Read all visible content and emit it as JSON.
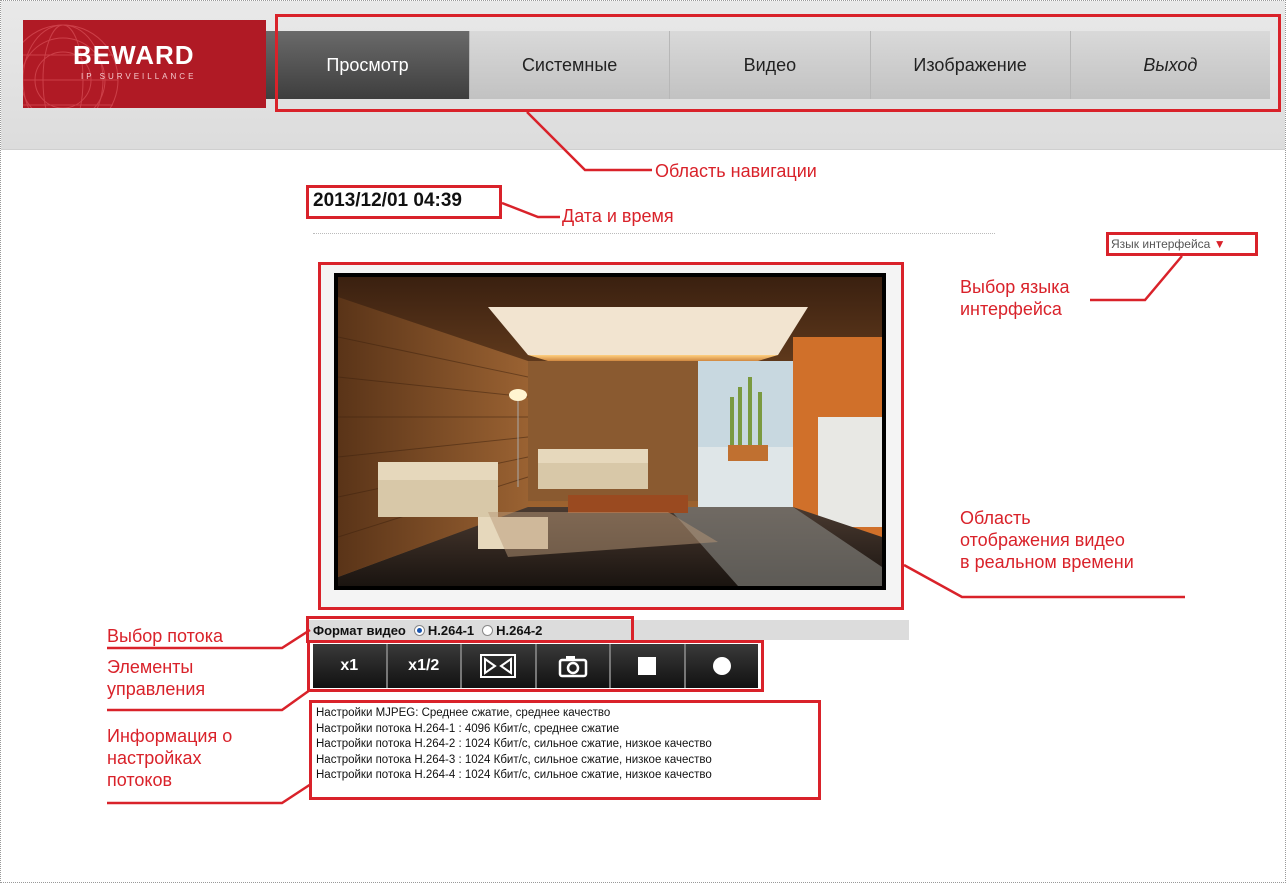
{
  "logo": {
    "brand": "BEWARD",
    "sub": "IP SURVEILLANCE"
  },
  "nav": {
    "items": [
      {
        "label": "Просмотр",
        "active": true
      },
      {
        "label": "Системные"
      },
      {
        "label": "Видео"
      },
      {
        "label": "Изображение"
      },
      {
        "label": "Выход"
      }
    ]
  },
  "datetime": "2013/12/01 04:39",
  "language": {
    "label": "Язык интерфейса",
    "arrow": "▼"
  },
  "format": {
    "label": "Формат видео",
    "options": [
      {
        "label": "H.264-1",
        "selected": true
      },
      {
        "label": "H.264-2",
        "selected": false
      }
    ]
  },
  "controls": {
    "x1": "x1",
    "x12": "x1/2"
  },
  "info": [
    "Настройки MJPEG: Среднее сжатие, среднее качество",
    "Настройки потока H.264-1 : 4096 Кбит/с, среднее сжатие",
    "Настройки потока H.264-2 : 1024 Кбит/с, сильное сжатие, низкое качество",
    "Настройки потока H.264-3 : 1024 Кбит/с, сильное сжатие, низкое качество",
    "Настройки потока H.264-4 : 1024 Кбит/с, сильное сжатие, низкое качество"
  ],
  "annotations": {
    "nav": "Область навигации",
    "datetime": "Дата и время",
    "lang_line1": "Выбор языка",
    "lang_line2": "интерфейса",
    "video_line1": "Область",
    "video_line2": "отображения видео",
    "video_line3": "в реальном времени",
    "stream": "Выбор потока",
    "controls_line1": "Элементы",
    "controls_line2": "управления",
    "info_line1": "Информация о",
    "info_line2": "настройках",
    "info_line3": "потоков"
  },
  "colors": {
    "accent": "#d9222a",
    "brand": "#b01a25"
  }
}
